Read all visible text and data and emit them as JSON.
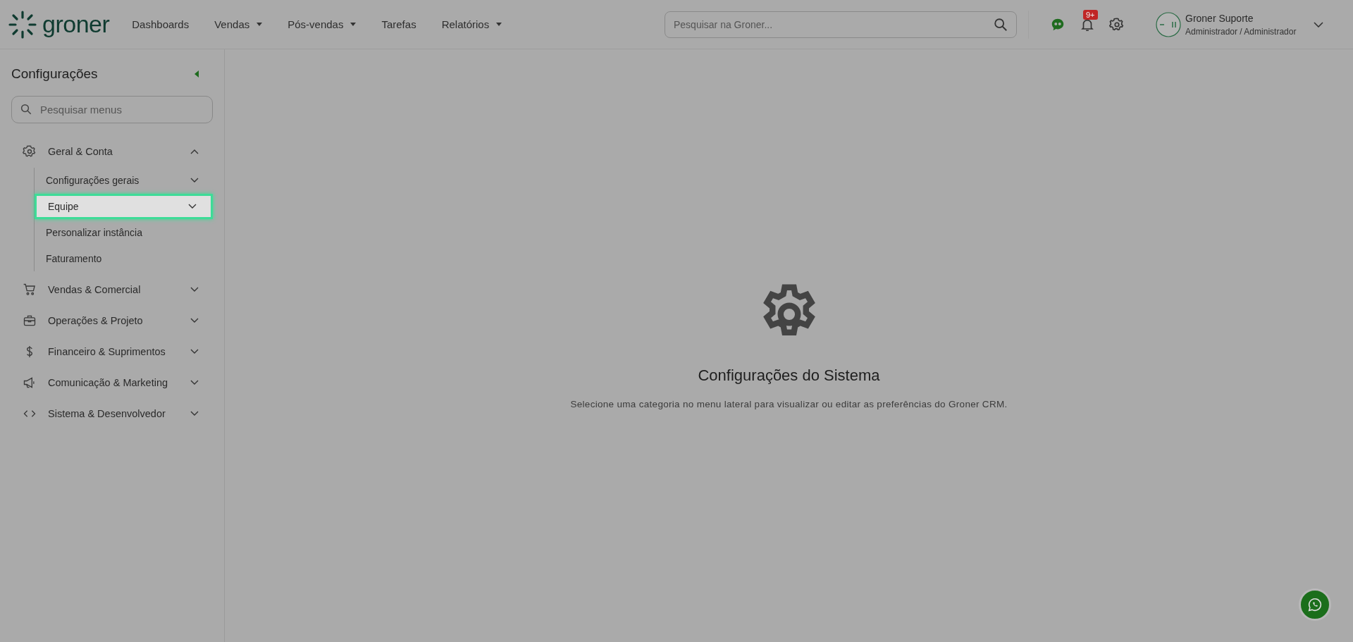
{
  "header": {
    "logo": "groner",
    "nav": [
      {
        "label": "Dashboards",
        "dropdown": false
      },
      {
        "label": "Vendas",
        "dropdown": true
      },
      {
        "label": "Pós-vendas",
        "dropdown": true
      },
      {
        "label": "Tarefas",
        "dropdown": false
      },
      {
        "label": "Relatórios",
        "dropdown": true
      }
    ],
    "search": {
      "placeholder": "Pesquisar na Groner..."
    },
    "notifications": {
      "badge": "9+"
    },
    "user": {
      "name": "Groner Suporte",
      "role": "Administrador / Administrador"
    }
  },
  "sidebar": {
    "title": "Configurações",
    "search": {
      "placeholder": "Pesquisar menus"
    },
    "groups": [
      {
        "label": "Geral & Conta",
        "expanded": true,
        "children": [
          {
            "label": "Configurações gerais",
            "expandable": true,
            "selected": false
          },
          {
            "label": "Equipe",
            "expandable": true,
            "selected": true
          },
          {
            "label": "Personalizar instância",
            "expandable": false,
            "selected": false
          },
          {
            "label": "Faturamento",
            "expandable": false,
            "selected": false
          }
        ]
      },
      {
        "label": "Vendas & Comercial",
        "expanded": false
      },
      {
        "label": "Operações & Projeto",
        "expanded": false
      },
      {
        "label": "Financeiro & Suprimentos",
        "expanded": false
      },
      {
        "label": "Comunicação & Marketing",
        "expanded": false
      },
      {
        "label": "Sistema & Desenvolvedor",
        "expanded": false
      }
    ]
  },
  "main": {
    "title": "Configurações do Sistema",
    "subtitle": "Selecione uma categoria no menu lateral para visualizar ou editar as preferências do Groner CRM."
  }
}
